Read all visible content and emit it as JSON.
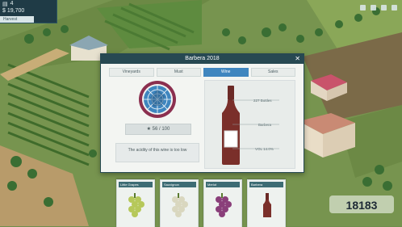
{
  "hud": {
    "days_label": "4",
    "money": "$ 19,700",
    "sub_label": "Harvest"
  },
  "modal": {
    "title": "Barbera 2018",
    "close_label": "✕",
    "tabs": [
      {
        "label": "Vineyards"
      },
      {
        "label": "Must"
      },
      {
        "label": "Wine"
      },
      {
        "label": "Sales"
      }
    ],
    "active_tab": 2,
    "score_text": "★ 56 / 100",
    "description": "The acidity of this wine is too low",
    "bottle_labels": {
      "l1": "227 Bottles",
      "l2": "Barbera",
      "l3": "VOL 14.0%"
    }
  },
  "cards": [
    {
      "title": "Little Grapes",
      "fruit": "grape-green-icon"
    },
    {
      "title": "Sauvignon",
      "fruit": "grape-white-icon"
    },
    {
      "title": "Merlot",
      "fruit": "grape-purple-icon"
    },
    {
      "title": "Barbera",
      "fruit": "bottle-icon"
    }
  ],
  "watermark": "18183",
  "colors": {
    "accent": "#3f86bf",
    "header": "#274952",
    "wine": "#7a2f2a"
  }
}
